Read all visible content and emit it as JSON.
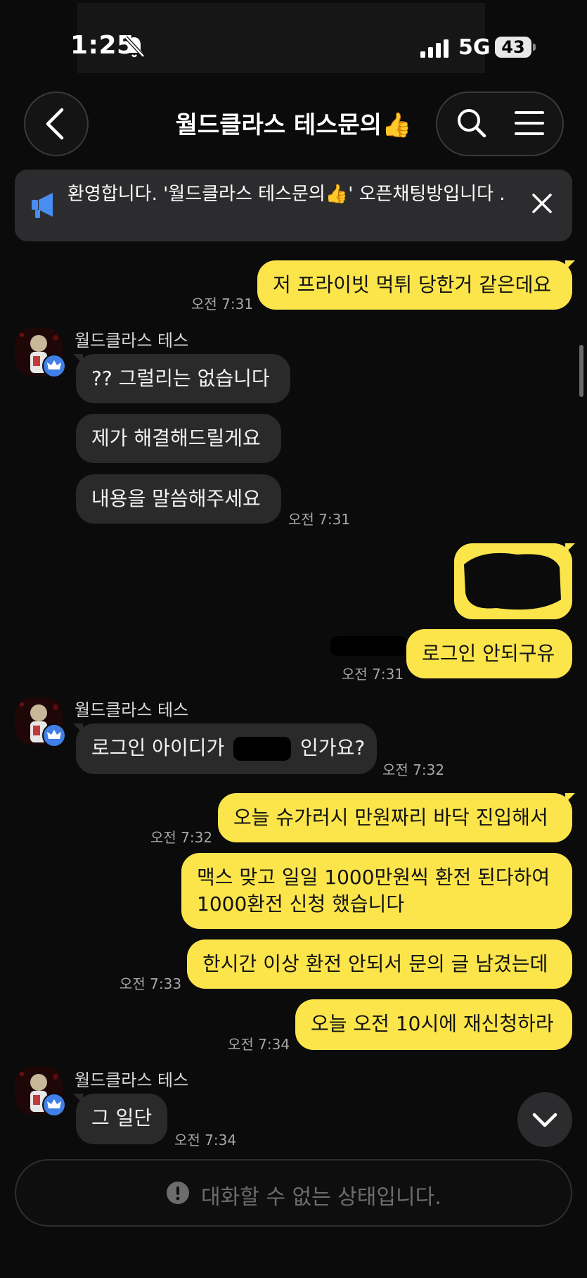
{
  "status_bar": {
    "time": "1:25",
    "network": "5G",
    "battery": "43"
  },
  "header": {
    "title": "월드클라스 테스문의👍"
  },
  "notice": {
    "text": "환영합니다. '월드클라스 테스문의👍' 오픈채팅방입니다 ."
  },
  "sender_name": "월드클라스 테스",
  "messages": {
    "m1": {
      "text": "저 프라이빗 먹튀 당한거 같은데요",
      "time": "오전 7:31"
    },
    "r1": {
      "text": "?? 그럴리는 없습니다"
    },
    "r2": {
      "text": "제가 해결해드릴게요"
    },
    "r3": {
      "text": "내용을 말씀해주세요",
      "time": "오전 7:31"
    },
    "m2": {
      "text": "로그인 안되구유",
      "time": "오전 7:31"
    },
    "r4": {
      "text_before": "로그인 아이디가",
      "text_after": "인가요?",
      "time": "오전 7:32"
    },
    "m3": {
      "text": "오늘 슈가러시 만원짜리 바닥 진입해서",
      "time": "오전 7:32"
    },
    "m4": {
      "line1": "맥스 맞고 일일 1000만원씩 환전 된다하여",
      "line2": "1000환전 신청 했습니다"
    },
    "m5": {
      "text": "한시간 이상 환전 안되서 문의 글 남겼는데",
      "time": "오전 7:33"
    },
    "m6": {
      "text": "오늘 오전 10시에 재신청하라",
      "time": "오전 7:34"
    },
    "r5": {
      "text": "그 일단",
      "time": "오전 7:34"
    }
  },
  "input": {
    "placeholder": "대화할 수 없는 상태입니다."
  },
  "icons": [
    "back-arrow-icon",
    "search-icon",
    "menu-icon",
    "megaphone-icon",
    "close-icon",
    "crown-icon",
    "chevron-down-icon",
    "alert-icon",
    "bell-slash-icon",
    "signal-icon"
  ],
  "colors": {
    "my_bubble": "#fbe54b",
    "their_bubble": "#2a2a2a",
    "background": "#0b0b0b"
  }
}
